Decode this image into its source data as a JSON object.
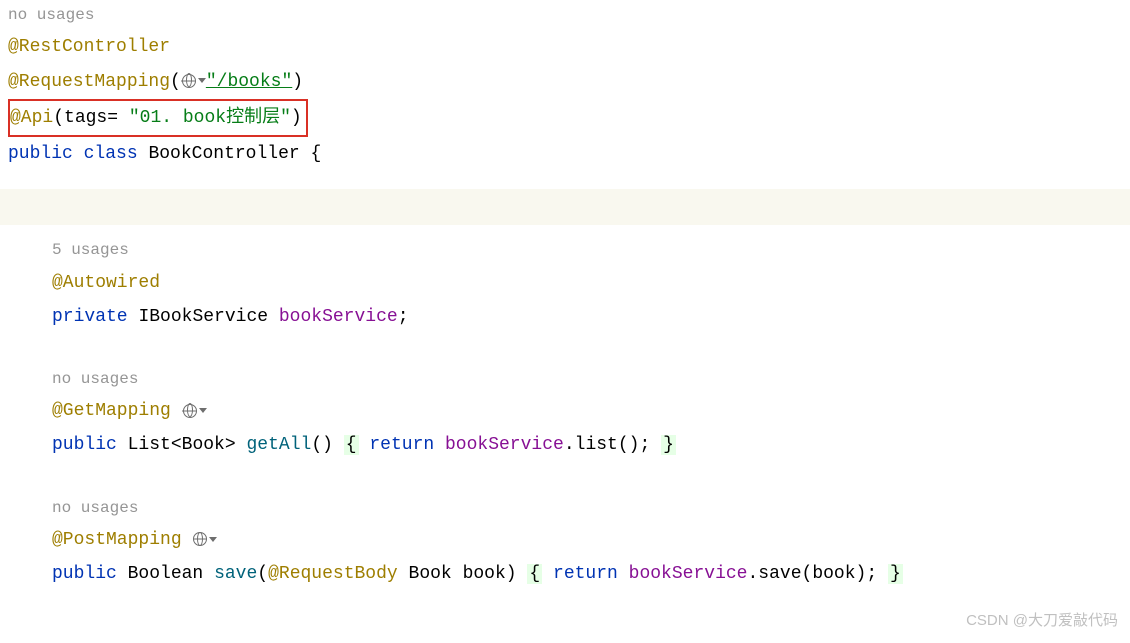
{
  "hints": {
    "noUsages": "no usages",
    "fiveUsages": "5 usages"
  },
  "annotations": {
    "restController": "@RestController",
    "requestMapping": "@RequestMapping",
    "api": "@Api",
    "autowired": "@Autowired",
    "getMapping": "@GetMapping",
    "postMapping": "@PostMapping",
    "requestBody": "@RequestBody"
  },
  "strings": {
    "booksPath": "\"/books\"",
    "apiTag": "\"01. book控制层\""
  },
  "keywords": {
    "public": "public",
    "class": "class",
    "private": "private",
    "return": "return"
  },
  "identifiers": {
    "className": "BookController",
    "serviceType": "IBookService",
    "serviceField": "bookService",
    "listType": "List",
    "bookType": "Book",
    "booleanType": "Boolean",
    "getAllMethod": "getAll",
    "saveMethod": "save",
    "listMethod": "list",
    "saveCall": "save",
    "bookParam": "book",
    "tagsParam": "tags"
  },
  "punctuation": {
    "openParen": "(",
    "closeParen": ")",
    "openBrace": "{",
    "closeBrace": "}",
    "semicolon": ";",
    "equals": "= ",
    "lt": "<",
    "gt": ">",
    "dot": "."
  },
  "watermark": "CSDN @大刀爱敲代码"
}
